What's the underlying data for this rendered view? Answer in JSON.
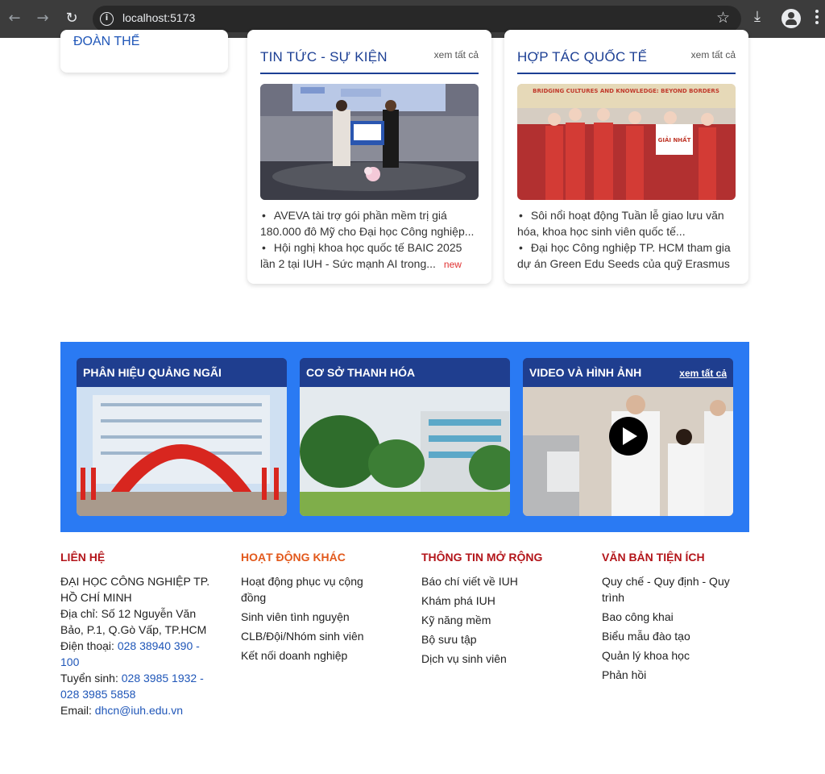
{
  "browser": {
    "url": "localhost:5173"
  },
  "sidebar": {
    "item_label": "ĐOÀN THỂ"
  },
  "news": {
    "title": "TIN TỨC - SỰ KIỆN",
    "more": "xem tất cả",
    "items": [
      {
        "line1": "AVEVA tài trợ gói phần mềm trị giá",
        "line2": "180.000 đô Mỹ cho Đại học Công nghiệp..."
      },
      {
        "line1": "Hội nghị khoa học quốc tế BAIC 2025",
        "line2": "lần 2 tại IUH - Sức mạnh AI trong...",
        "badge": "new"
      }
    ]
  },
  "intl": {
    "title": "HỢP TÁC QUỐC TẾ",
    "more": "xem tất cả",
    "banner_text": "BRIDGING CULTURES AND KNOWLEDGE: BEYOND BORDERS",
    "prize_text": "GIẢI NHẤT",
    "items": [
      {
        "line1": "Sôi nổi hoạt động Tuần lễ giao lưu văn",
        "line2": "hóa, khoa học sinh viên quốc tế..."
      },
      {
        "line1": "Đại học Công nghiệp TP. HCM tham gia",
        "line2": "dự án Green Edu Seeds của quỹ Erasmus"
      }
    ]
  },
  "band": {
    "tiles": [
      {
        "title": "PHÂN HIỆU QUẢNG NGÃI"
      },
      {
        "title": "CƠ SỞ THANH HÓA"
      },
      {
        "title": "VIDEO VÀ HÌNH ẢNH",
        "more": "xem tất cả"
      }
    ]
  },
  "footer": {
    "contact": {
      "heading": "LIÊN HỆ",
      "org1": "ĐẠI HỌC CÔNG NGHIỆP TP.",
      "org2": "HỒ CHÍ MINH",
      "addr1": "Địa chỉ: Số 12 Nguyễn Văn",
      "addr2": "Bảo, P.1, Q.Gò Vấp, TP.HCM",
      "phone_label": "Điện thoại: ",
      "phone1": "028 38940 390 -",
      "phone2": "100",
      "admit_label": "Tuyển sinh: ",
      "admit1": "028 3985 1932 -",
      "admit2": "028 3985 5858",
      "email_label": "Email: ",
      "email": "dhcn@iuh.edu.vn"
    },
    "activities": {
      "heading": "HOẠT ĐỘNG KHÁC",
      "links": [
        "Hoạt động phục vụ cộng",
        "đồng",
        "Sinh viên tình nguyện",
        "CLB/Đội/Nhóm sinh viên",
        "Kết nối doanh nghiệp"
      ]
    },
    "info": {
      "heading": "THÔNG TIN MỞ RỘNG",
      "links": [
        "Báo chí viết về IUH",
        "Khám phá IUH",
        "Kỹ năng mềm",
        "Bộ sưu tập",
        "Dịch vụ sinh viên"
      ]
    },
    "docs": {
      "heading": "VĂN BẢN TIỆN ÍCH",
      "links": [
        "Quy chế - Quy định - Quy",
        "trình",
        "Bao công khai",
        "Biểu mẫu đào tạo",
        "Quản lý khoa học",
        "Phản hồi"
      ]
    },
    "colors": {
      "contact": "#b3151a",
      "activities": "#e2591c",
      "info": "#b3151a",
      "docs": "#b3151a"
    }
  }
}
